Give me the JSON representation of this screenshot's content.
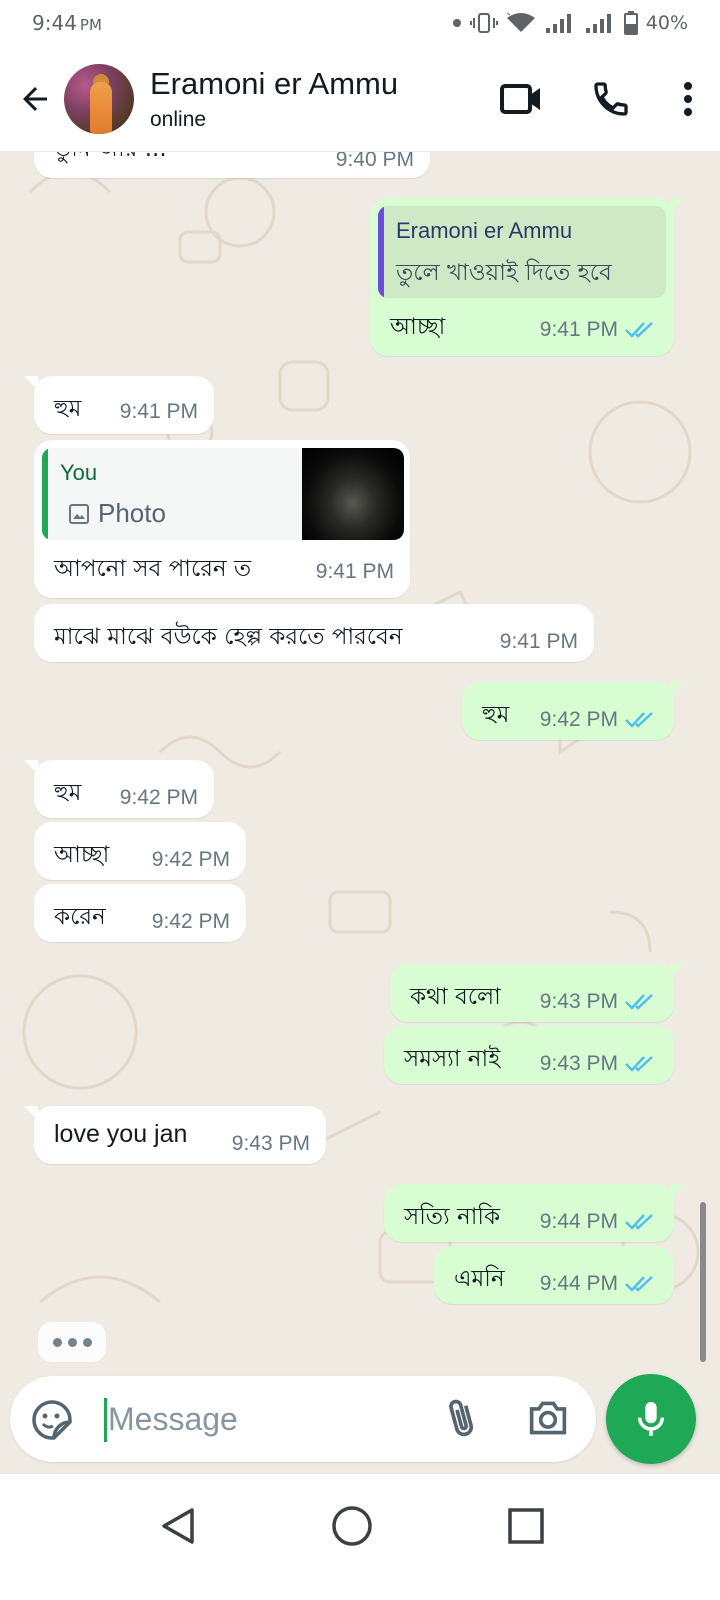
{
  "status_bar": {
    "time": "9:44",
    "ampm": "PM",
    "battery": "40%"
  },
  "header": {
    "contact_name": "Eramoni er Ammu",
    "status": "online"
  },
  "messages": [
    {
      "dir": "in",
      "text": "তুমি আর ...",
      "time": "9:40 PM"
    },
    {
      "dir": "out",
      "quote_name": "Eramoni er Ammu",
      "quote_text": "তুলে খাওয়াই দিতে হবে",
      "text": "আচ্ছা",
      "time": "9:41 PM"
    },
    {
      "dir": "in",
      "text": "হুম",
      "time": "9:41 PM"
    },
    {
      "dir": "in",
      "quote_name": "You",
      "quote_text": "Photo",
      "text": "আপনো সব পারেন ত",
      "time": "9:41 PM"
    },
    {
      "dir": "in",
      "text": "মাঝে মাঝে বউকে হেল্প করতে পারবেন",
      "time": "9:41 PM"
    },
    {
      "dir": "out",
      "text": "হুম",
      "time": "9:42 PM"
    },
    {
      "dir": "in",
      "text": "হুম",
      "time": "9:42 PM"
    },
    {
      "dir": "in",
      "text": "আচ্ছা",
      "time": "9:42 PM"
    },
    {
      "dir": "in",
      "text": "করেন",
      "time": "9:42 PM"
    },
    {
      "dir": "out",
      "text": "কথা বলো",
      "time": "9:43 PM"
    },
    {
      "dir": "out",
      "text": "সমস্যা নাই",
      "time": "9:43 PM"
    },
    {
      "dir": "in",
      "text": "love you jan",
      "time": "9:43 PM"
    },
    {
      "dir": "out",
      "text": "সত্যি নাকি",
      "time": "9:44 PM"
    },
    {
      "dir": "out",
      "text": "এমনি",
      "time": "9:44 PM"
    }
  ],
  "composer": {
    "placeholder": "Message"
  },
  "colors": {
    "accent": "#1fa855",
    "outgoing_bubble": "#d9fdd3",
    "read_ticks": "#53bdeb",
    "quote_bar_out": "#6a4fd6",
    "quote_bar_in": "#1fa855",
    "quote_name_out": "#2a3a6b",
    "quote_name_in": "#0c6b3a"
  },
  "icons": {
    "back": "arrow-left-icon",
    "video": "video-camera-icon",
    "call": "phone-icon",
    "more": "more-vertical-icon",
    "sticker": "sticker-icon",
    "attach": "paperclip-icon",
    "camera": "camera-icon",
    "mic": "microphone-icon"
  }
}
